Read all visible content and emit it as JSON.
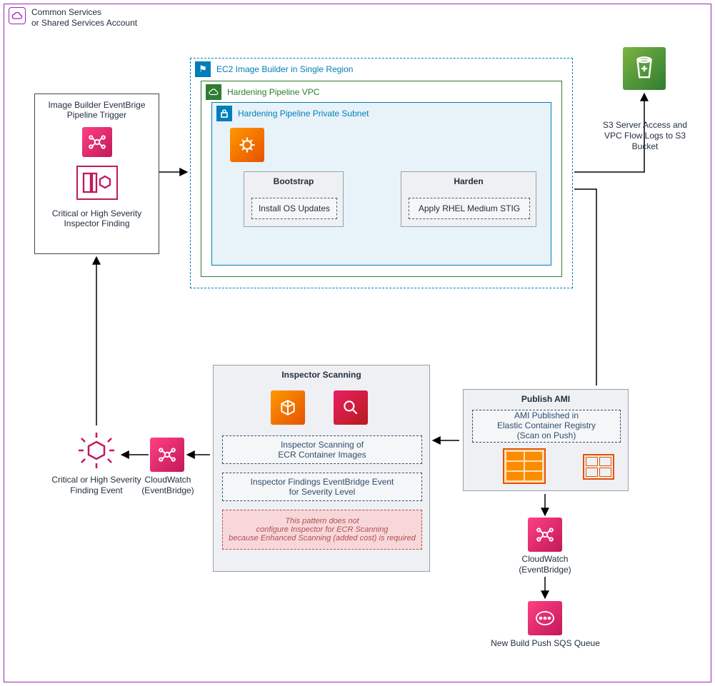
{
  "account": {
    "title": "Common Services\nor Shared Services Account"
  },
  "trigger": {
    "title": "Image Builder EventBrige\nPipeline Trigger",
    "finding": "Critical or High Severity\nInspector Finding"
  },
  "region": {
    "title": "EC2 Image Builder in Single Region"
  },
  "vpc": {
    "title": "Hardening Pipeline VPC"
  },
  "subnet": {
    "title": "Hardening Pipeline Private Subnet"
  },
  "stages": {
    "bootstrap": {
      "title": "Bootstrap",
      "step": "Install OS Updates"
    },
    "harden": {
      "title": "Harden",
      "step": "Apply RHEL Medium STIG"
    }
  },
  "s3": {
    "caption": "S3 Server Access and\nVPC Flow Logs to S3 Bucket"
  },
  "publish": {
    "title": "Publish AMI",
    "desc": "AMI Published in\nElastic Container Registry\n(Scan on Push)"
  },
  "cloudwatch_right": "CloudWatch\n(EventBridge)",
  "sqs": "New Build Push SQS Queue",
  "inspector": {
    "title": "Inspector Scanning",
    "line1": "Inspector Scanning of\nECR Container Images",
    "line2": "Inspector Findings EventBridge Event\nfor Severity Level",
    "warn": "This pattern does not\nconfigure Inspector for ECR Scanning\nbecause Enhanced Scanning (added cost) is required"
  },
  "cloudwatch_left": "CloudWatch\n(EventBridge)",
  "finding_event": "Critical or High Severity\nFinding Event"
}
